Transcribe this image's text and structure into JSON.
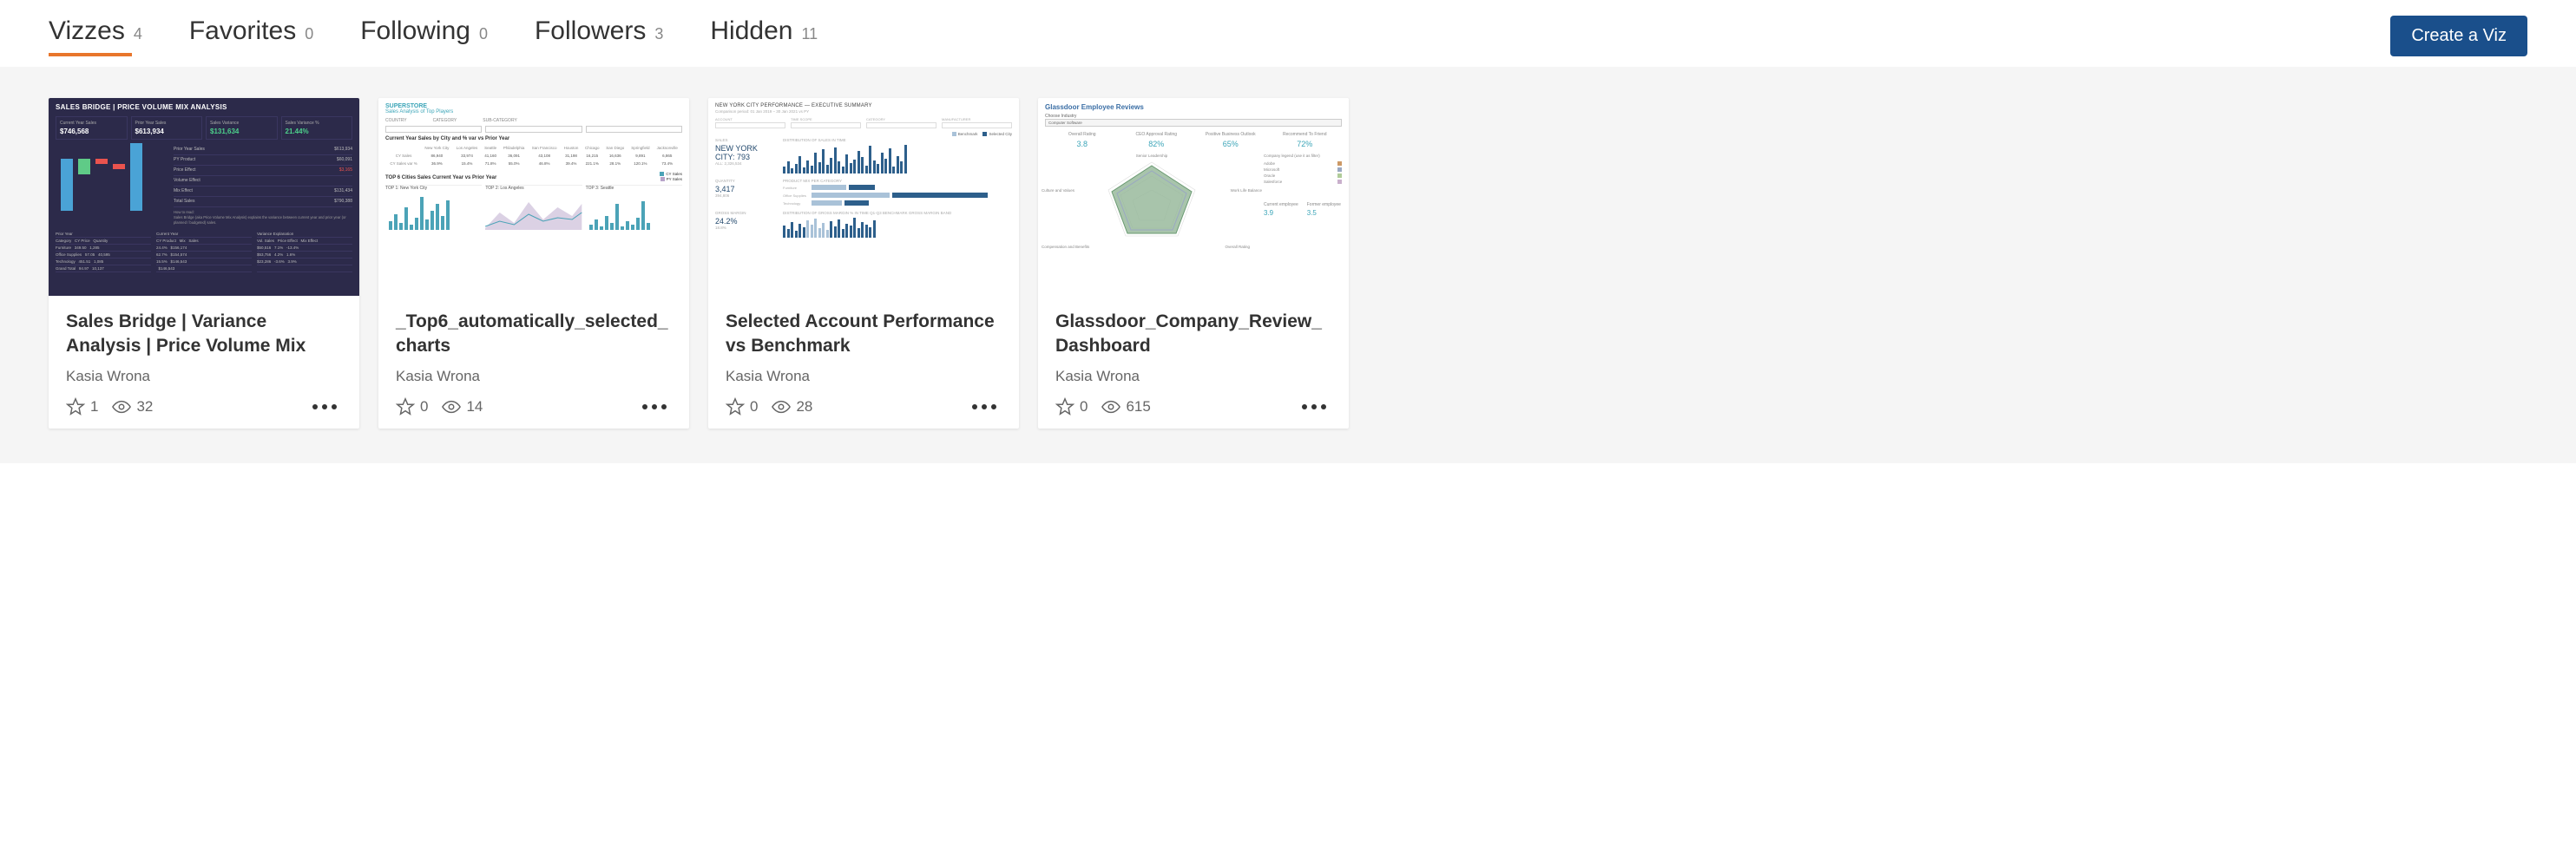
{
  "tabs": [
    {
      "label": "Vizzes",
      "count": "4",
      "active": true
    },
    {
      "label": "Favorites",
      "count": "0",
      "active": false
    },
    {
      "label": "Following",
      "count": "0",
      "active": false
    },
    {
      "label": "Followers",
      "count": "3",
      "active": false
    },
    {
      "label": "Hidden",
      "count": "11",
      "active": false
    }
  ],
  "create_button": "Create a Viz",
  "cards": [
    {
      "title": "Sales Bridge | Variance Analysis | Price Volume Mix",
      "author": "Kasia Wrona",
      "favs": "1",
      "views": "32",
      "thumb": {
        "header": "SALES BRIDGE | PRICE VOLUME MIX ANALYSIS",
        "kpis": [
          {
            "label": "Current Year Sales",
            "val": "$746,568",
            "cls": ""
          },
          {
            "label": "Prior Year Sales",
            "val": "$613,934",
            "cls": ""
          },
          {
            "label": "Sales Variance",
            "val": "$131,634",
            "cls": "green"
          },
          {
            "label": "Sales Variance %",
            "val": "21.44%",
            "cls": "green"
          }
        ],
        "side": [
          {
            "l": "Prior Year Sales",
            "r": "$613,934"
          },
          {
            "l": "PY Product",
            "r": "$60,091"
          },
          {
            "l": "Price Effect",
            "r": "$3,165"
          },
          {
            "l": "Volume Effect",
            "r": ""
          },
          {
            "l": "Mix Effect",
            "r": "$131,434"
          },
          {
            "l": "Total Sales",
            "r": "$790,388"
          }
        ]
      }
    },
    {
      "title": "_Top6_automatically_selected_charts",
      "author": "Kasia Wrona",
      "favs": "0",
      "views": "14",
      "thumb": {
        "h1": "SUPERSTORE",
        "h2": "Sales Analysis of Top Players",
        "filters": [
          "COUNTRY",
          "CATEGORY",
          "SUB-CATEGORY"
        ],
        "section1": "Current Year Sales by City and % var vs Prior Year",
        "cities": [
          "New York City",
          "Los Angeles",
          "Seattle",
          "Philadelphia",
          "San Francisco",
          "Houston",
          "Chicago",
          "San Diego",
          "Springfield",
          "Jacksonville"
        ],
        "cy": [
          "86,940",
          "33,974",
          "41,160",
          "36,091",
          "43,108",
          "31,198",
          "16,215",
          "16,636",
          "9,891",
          "6,865"
        ],
        "var": [
          "36.9%",
          "15.4%",
          "71.8%",
          "55.0%",
          "46.8%",
          "39.4%",
          "221.1%",
          "28.1%",
          "120.1%",
          "73.4%"
        ],
        "section2": "TOP 6 Cities Sales Current Year vs Prior Year",
        "legend": [
          "CY Sales",
          "PY Sales"
        ],
        "mini": [
          "TOP 1: New York City",
          "TOP 2: Los Angeles",
          "TOP 3: Seattle"
        ]
      }
    },
    {
      "title": "Selected Account Performance vs Benchmark",
      "author": "Kasia Wrona",
      "favs": "0",
      "views": "28",
      "thumb": {
        "h1": "NEW YORK CITY PERFORMANCE — EXECUTIVE SUMMARY",
        "sub": "Comparison period: 01 Jan 2019 – 30 Jan 2021 vs PY",
        "filters": [
          "ACCOUNT",
          "TIME SCOPE",
          "CATEGORY",
          "MANUFACTURER"
        ],
        "legend": [
          "Benchmark",
          "Selected City"
        ],
        "rows": [
          {
            "klabel": "SALES",
            "kval": "NEW YORK CITY: 793",
            "ksub": "ALL: 2,326,534",
            "ctitle": "DISTRIBUTION OF SALES IN TIME"
          },
          {
            "klabel": "QUANTITY",
            "kval": "3,417",
            "ksub": "394,806",
            "ctitle": "PRODUCT MIX PER CATEGORY"
          },
          {
            "klabel": "GROSS MARGIN",
            "kval": "24.2%",
            "ksub": "18.8%",
            "ctitle": "DISTRIBUTION OF GROSS MARGIN % IN TIME Q1-Q3 BENCHMARK GROSS MARGIN BAND"
          }
        ],
        "cats": [
          "Furniture",
          "Office Supplies",
          "Technology"
        ]
      }
    },
    {
      "title": "Glassdoor_Company_Review_Dashboard",
      "author": "Kasia Wrona",
      "favs": "0",
      "views": "615",
      "thumb": {
        "h1": "Glassdoor Employee Reviews",
        "choose": "Choose Industry",
        "selected": "Computer Software",
        "kpis": [
          {
            "label": "Overall Rating",
            "val": "3.8"
          },
          {
            "label": "CEO Approval Rating",
            "val": "82%"
          },
          {
            "label": "Positive Business Outlook",
            "val": "65%"
          },
          {
            "label": "Recommend To Friend",
            "val": "72%"
          }
        ],
        "axes": [
          "Senior Leadership",
          "Work Life Balance",
          "Overall Rating",
          "Compensation and Benefits",
          "Culture and Values"
        ],
        "legend_title": "Company legend (use it as filter)",
        "legend": [
          "Adobe",
          "Microsoft",
          "Oracle",
          "Salesforce"
        ],
        "bottom": [
          {
            "label": "Current employee",
            "val": "3.9"
          },
          {
            "label": "Former employee",
            "val": "3.5"
          }
        ]
      }
    }
  ]
}
